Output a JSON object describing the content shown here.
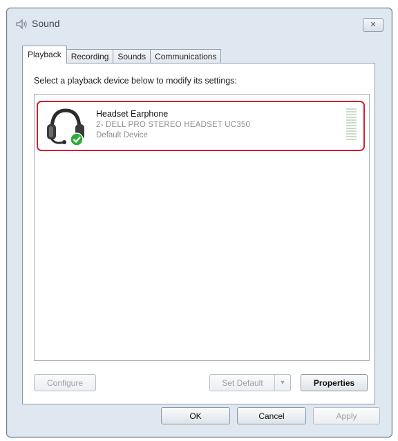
{
  "window": {
    "title": "Sound",
    "close_label": "✕"
  },
  "tabs": [
    {
      "label": "Playback",
      "active": true
    },
    {
      "label": "Recording",
      "active": false
    },
    {
      "label": "Sounds",
      "active": false
    },
    {
      "label": "Communications",
      "active": false
    }
  ],
  "panel": {
    "instruction": "Select a playback device below to modify its settings:"
  },
  "devices": [
    {
      "name": "Headset Earphone",
      "description": "2- DELL PRO STEREO HEADSET UC350",
      "status": "Default Device",
      "icon": "headset-icon",
      "badge": "green-check-icon"
    }
  ],
  "panel_buttons": {
    "configure": "Configure",
    "set_default": "Set Default",
    "properties": "Properties"
  },
  "dialog_buttons": {
    "ok": "OK",
    "cancel": "Cancel",
    "apply": "Apply"
  },
  "colors": {
    "highlight_border": "#d21f2f",
    "window_bg": "#dfe7f1",
    "check_green": "#2eaa3a"
  }
}
